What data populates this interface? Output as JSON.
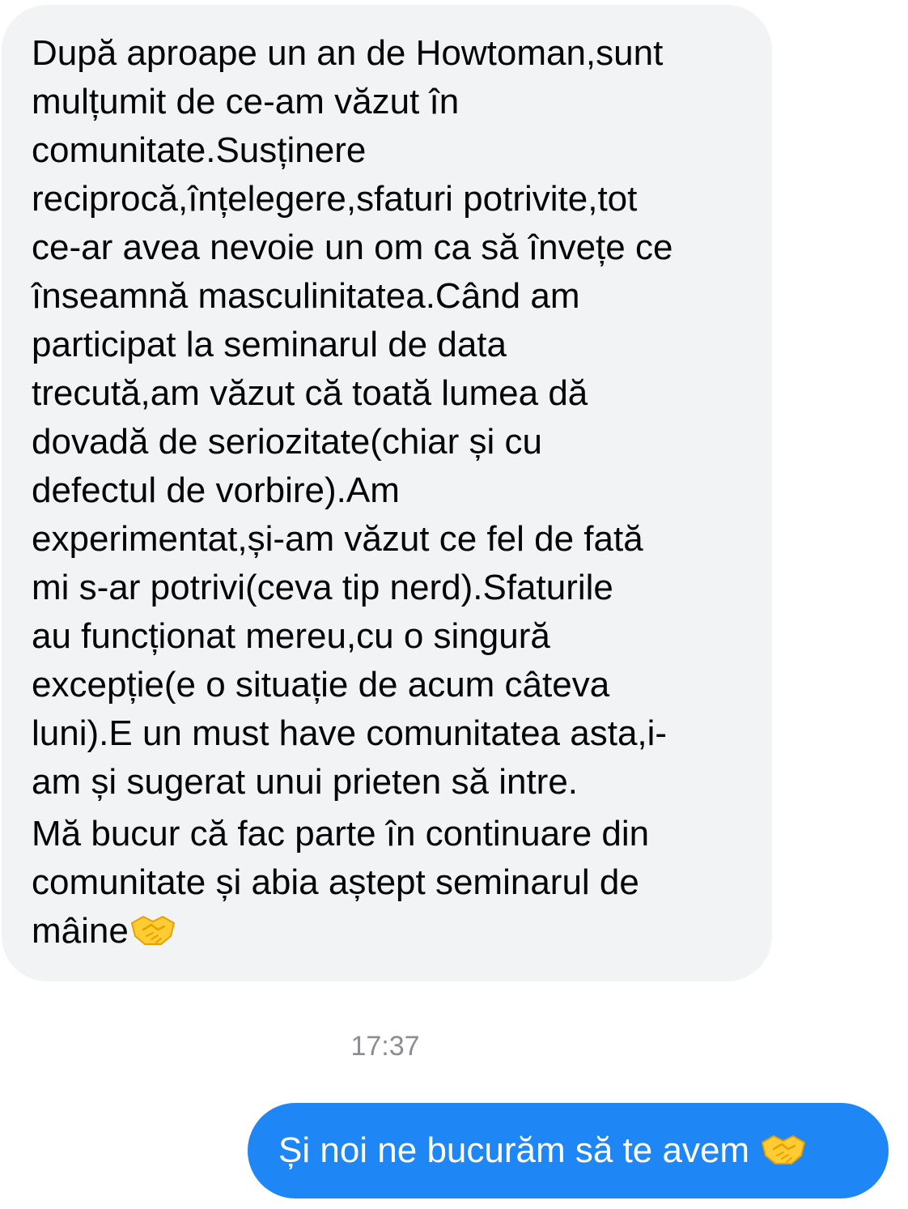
{
  "incoming_message": {
    "lines": [
      "După aproape un an de Howtoman,sunt",
      "mulțumit de ce-am văzut în",
      "comunitate.Susținere",
      "reciprocă,înțelegere,sfaturi potrivite,tot",
      "ce-ar avea nevoie un om ca să învețe ce",
      "înseamnă masculinitatea.Când am",
      "participat la seminarul de data",
      "trecută,am văzut că toată lumea dă",
      "dovadă de seriozitate(chiar și cu",
      "defectul de vorbire).Am",
      "experimentat,și-am văzut ce fel de fată",
      "mi s-ar potrivi(ceva tip nerd).Sfaturile",
      "au funcționat mereu,cu o singură",
      "excepție(e o situație de acum câteva",
      "luni).E un must have comunitatea asta,i-",
      "am și sugerat unui prieten să intre."
    ],
    "closing_lines": [
      "Mă bucur că fac parte în continuare din",
      "comunitate și abia aștept seminarul de"
    ],
    "last_line": "mâine",
    "last_icon": "handshake-icon",
    "bubble_color": "#f2f3f5"
  },
  "timestamp": "17:37",
  "outgoing_message": {
    "text": "Și noi ne bucurăm să te avem",
    "icon": "handshake-icon",
    "bubble_color": "#1e86f5"
  }
}
